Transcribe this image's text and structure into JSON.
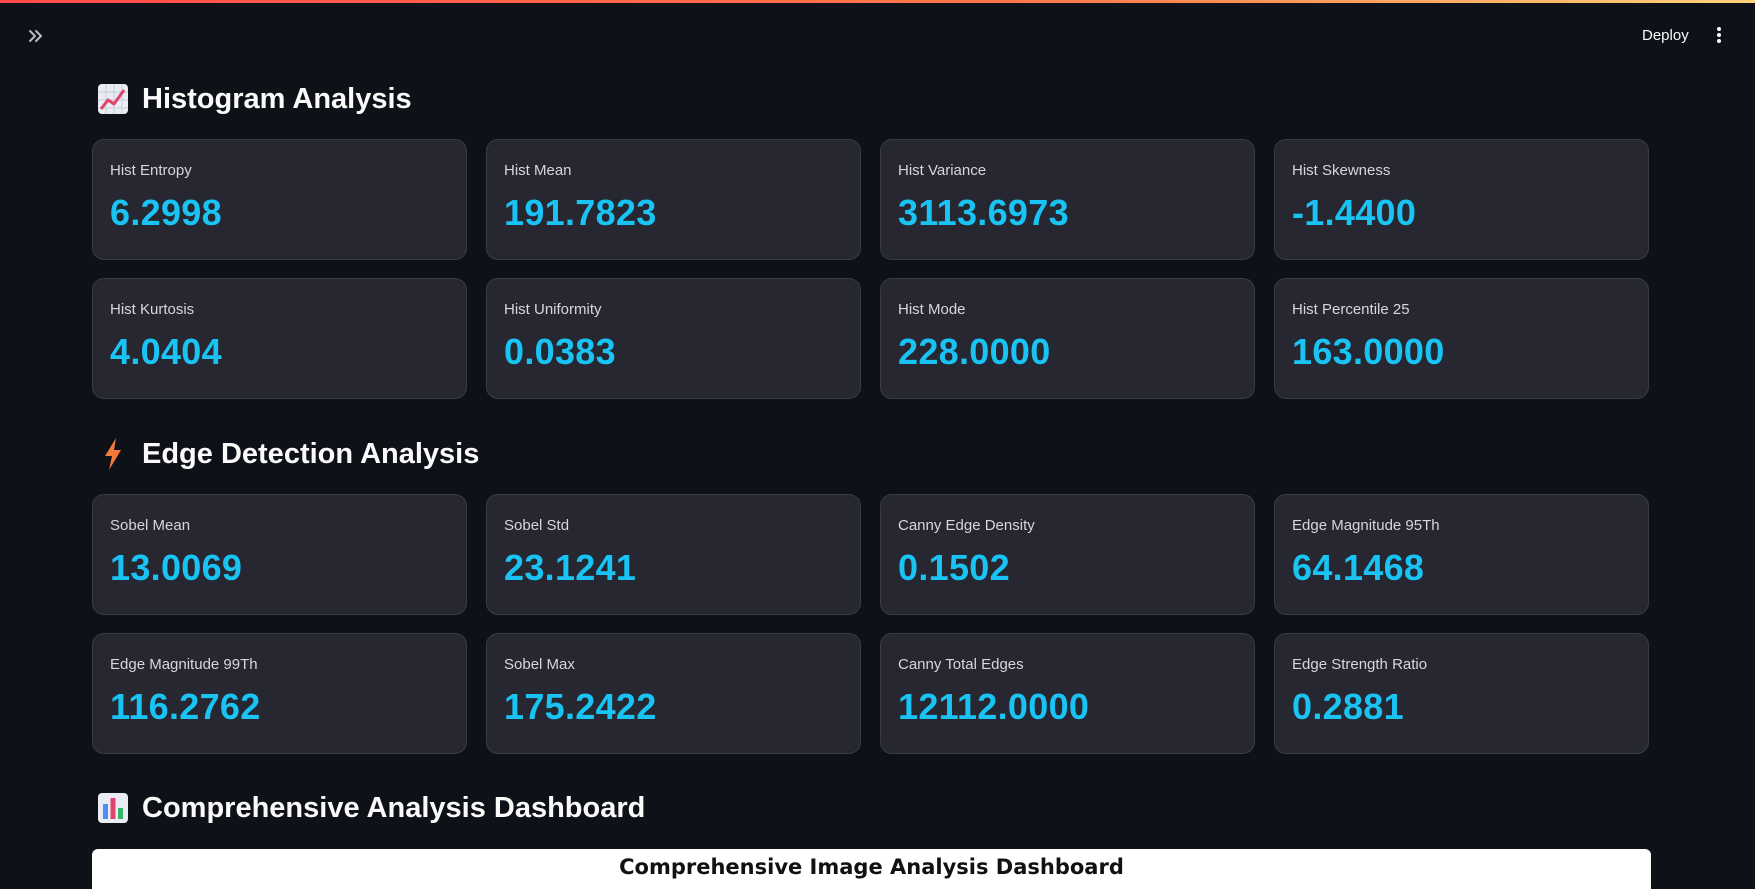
{
  "header": {
    "deploy_label": "Deploy"
  },
  "sections": {
    "histogram": {
      "title": "Histogram Analysis",
      "metrics": [
        {
          "label": "Hist Entropy",
          "value": "6.2998"
        },
        {
          "label": "Hist Mean",
          "value": "191.7823"
        },
        {
          "label": "Hist Variance",
          "value": "3113.6973"
        },
        {
          "label": "Hist Skewness",
          "value": "-1.4400"
        },
        {
          "label": "Hist Kurtosis",
          "value": "4.0404"
        },
        {
          "label": "Hist Uniformity",
          "value": "0.0383"
        },
        {
          "label": "Hist Mode",
          "value": "228.0000"
        },
        {
          "label": "Hist Percentile 25",
          "value": "163.0000"
        }
      ]
    },
    "edge": {
      "title": "Edge Detection Analysis",
      "metrics": [
        {
          "label": "Sobel Mean",
          "value": "13.0069"
        },
        {
          "label": "Sobel Std",
          "value": "23.1241"
        },
        {
          "label": "Canny Edge Density",
          "value": "0.1502"
        },
        {
          "label": "Edge Magnitude 95Th",
          "value": "64.1468"
        },
        {
          "label": "Edge Magnitude 99Th",
          "value": "116.2762"
        },
        {
          "label": "Sobel Max",
          "value": "175.2422"
        },
        {
          "label": "Canny Total Edges",
          "value": "12112.0000"
        },
        {
          "label": "Edge Strength Ratio",
          "value": "0.2881"
        }
      ]
    },
    "dashboard": {
      "title": "Comprehensive Analysis Dashboard",
      "figure_title": "Comprehensive Image Analysis Dashboard"
    }
  },
  "icons": {
    "expand": "chevrons-right-icon",
    "menu": "kebab-menu-icon",
    "histogram": "chart-increasing-icon",
    "edge": "lightning-icon",
    "dashboard": "bar-chart-icon"
  },
  "colors": {
    "background": "#0e1118",
    "card": "#262730",
    "value": "#19c3f4",
    "accent_gradient": [
      "#ff4b4b",
      "#ffd27a"
    ]
  }
}
